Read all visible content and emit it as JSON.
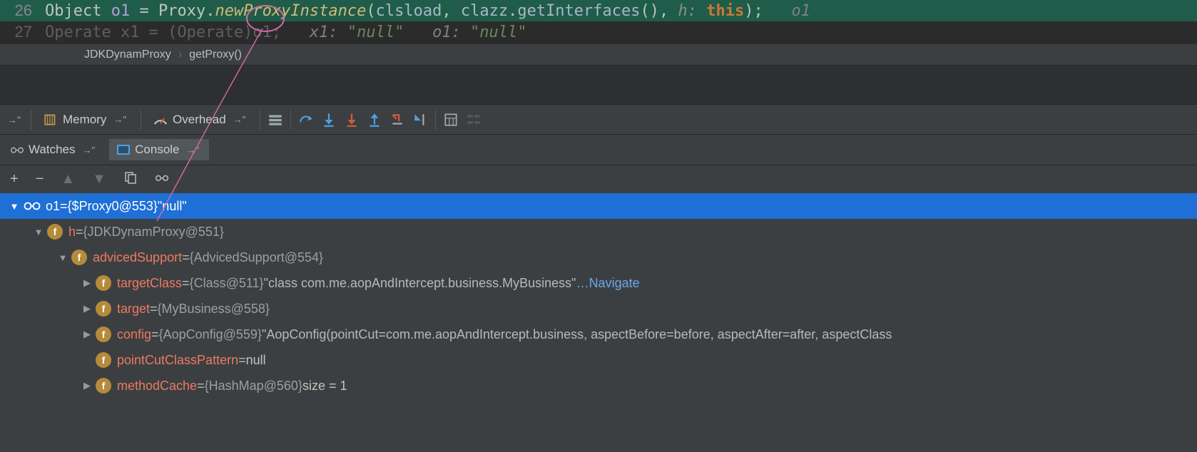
{
  "editor": {
    "line1": {
      "number": "26",
      "text_plain1": "Object ",
      "var": "o1",
      "text_plain2": " = ",
      "cls": "Proxy",
      "dot": ".",
      "method": "newProxyInstance",
      "args_open": "(",
      "arg1": "clsload",
      "comma1": ", ",
      "arg2": "clazz",
      "dot2": ".",
      "call2": "getInterfaces",
      "paren2": "()",
      "comma2": ", ",
      "hint": "h: ",
      "thisk": "this",
      "args_close": ");",
      "trail": "   o1"
    },
    "line2": {
      "number": "27",
      "prefix": "Operate x1 = (Operate)o1;",
      "hint1": "   x1: ",
      "val1": "\"null\"",
      "hint2": "   o1: ",
      "val2": "\"null\""
    }
  },
  "breadcrumb": {
    "a": "JDKDynamProxy",
    "b": "getProxy()"
  },
  "toolbar": {
    "memory": "Memory",
    "overhead": "Overhead"
  },
  "tabs": {
    "watches": "Watches",
    "console": "Console"
  },
  "tree": {
    "root": {
      "name": "o1",
      "eq": " = ",
      "val": "{$Proxy0@553} ",
      "str": "\"null\""
    },
    "h": {
      "name": "h",
      "eq": " = ",
      "val": "{JDKDynamProxy@551}"
    },
    "advSup": {
      "name": "advicedSupport",
      "eq": " = ",
      "val": "{AdvicedSupport@554}"
    },
    "targetClass": {
      "name": "targetClass",
      "eq": " = ",
      "val": "{Class@511} ",
      "str": "\"class com.me.aopAndIntercept.business.MyBusiness\"",
      "dots": "… ",
      "link": "Navigate"
    },
    "target": {
      "name": "target",
      "eq": " = ",
      "val": "{MyBusiness@558}"
    },
    "config": {
      "name": "config",
      "eq": " = ",
      "val": "{AopConfig@559} ",
      "str": "\"AopConfig(pointCut=com.me.aopAndIntercept.business, aspectBefore=before, aspectAfter=after, aspectClass"
    },
    "pcp": {
      "name": "pointCutClassPattern",
      "eq": " = ",
      "val": "null"
    },
    "mcache": {
      "name": "methodCache",
      "eq": " = ",
      "val": "{HashMap@560} ",
      "extra": " size = 1"
    }
  }
}
